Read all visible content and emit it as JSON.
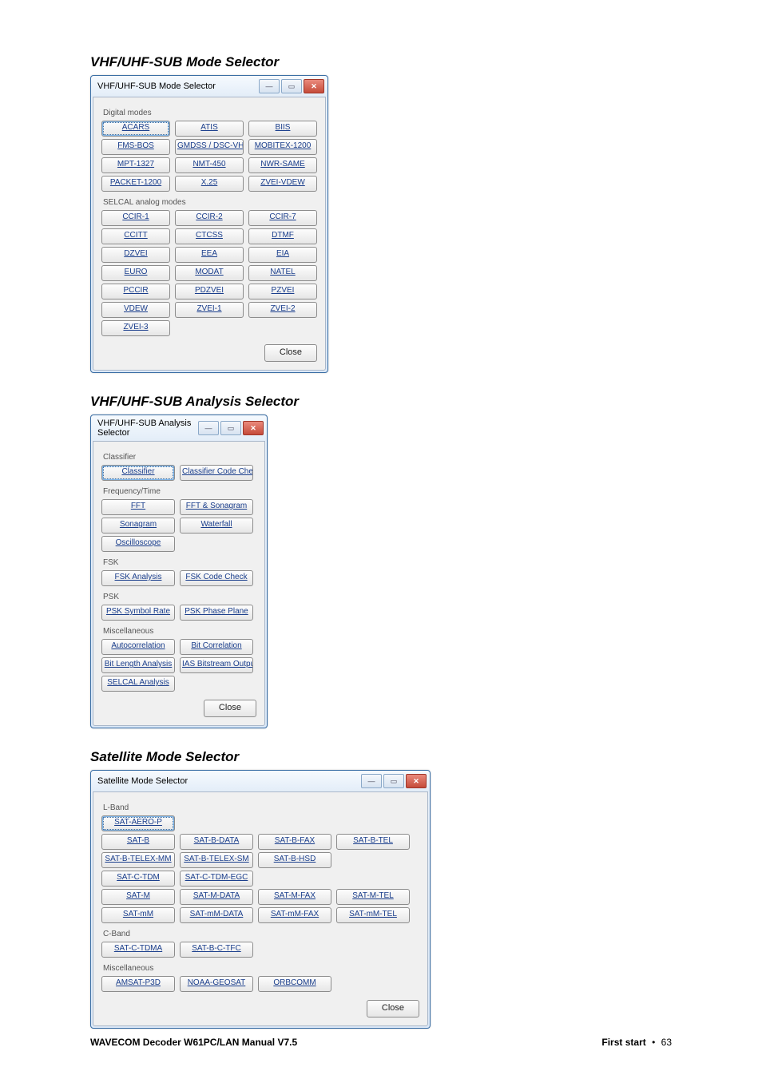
{
  "headings": {
    "h1": "VHF/UHF-SUB Mode Selector",
    "h2": "VHF/UHF-SUB Analysis Selector",
    "h3": "Satellite Mode Selector"
  },
  "win1": {
    "title": "VHF/UHF-SUB Mode Selector",
    "groups": {
      "digital": {
        "label": "Digital modes",
        "items": [
          "ACARS",
          "ATIS",
          "BIIS",
          "FMS-BOS",
          "GMDSS / DSC-VHF",
          "MOBITEX-1200",
          "MPT-1327",
          "NMT-450",
          "NWR-SAME",
          "PACKET-1200",
          "X.25",
          "ZVEI-VDEW"
        ]
      },
      "selcal": {
        "label": "SELCAL analog modes",
        "items": [
          "CCIR-1",
          "CCIR-2",
          "CCIR-7",
          "CCITT",
          "CTCSS",
          "DTMF",
          "DZVEI",
          "EEA",
          "EIA",
          "EURO",
          "MODAT",
          "NATEL",
          "PCCIR",
          "PDZVEI",
          "PZVEI",
          "VDEW",
          "ZVEI-1",
          "ZVEI-2",
          "ZVEI-3"
        ]
      }
    },
    "close": "Close"
  },
  "win2": {
    "title": "VHF/UHF-SUB Analysis Selector",
    "groups": {
      "classifier": {
        "label": "Classifier",
        "items": [
          "Classifier",
          "Classifier Code Check"
        ]
      },
      "freq": {
        "label": "Frequency/Time",
        "items": [
          "FFT",
          "FFT & Sonagram",
          "Sonagram",
          "Waterfall",
          "Oscilloscope"
        ]
      },
      "fsk": {
        "label": "FSK",
        "items": [
          "FSK Analysis",
          "FSK Code Check"
        ]
      },
      "psk": {
        "label": "PSK",
        "items": [
          "PSK Symbol Rate",
          "PSK Phase Plane"
        ]
      },
      "misc": {
        "label": "Miscellaneous",
        "items": [
          "Autocorrelation",
          "Bit Correlation",
          "Bit Length Analysis",
          "IAS Bitstream Output",
          "SELCAL Analysis"
        ]
      }
    },
    "close": "Close"
  },
  "win3": {
    "title": "Satellite Mode Selector",
    "groups": {
      "lband": {
        "label": "L-Band",
        "rows": [
          [
            "SAT-AERO-P"
          ],
          [
            "SAT-B",
            "SAT-B-DATA",
            "SAT-B-FAX",
            "SAT-B-TEL"
          ],
          [
            "SAT-B-TELEX-MM",
            "SAT-B-TELEX-SM",
            "SAT-B-HSD"
          ],
          [
            "SAT-C-TDM",
            "SAT-C-TDM-EGC"
          ],
          [
            "SAT-M",
            "SAT-M-DATA",
            "SAT-M-FAX",
            "SAT-M-TEL"
          ],
          [
            "SAT-mM",
            "SAT-mM-DATA",
            "SAT-mM-FAX",
            "SAT-mM-TEL"
          ]
        ]
      },
      "cband": {
        "label": "C-Band",
        "rows": [
          [
            "SAT-C-TDMA",
            "SAT-B-C-TFC"
          ]
        ]
      },
      "misc": {
        "label": "Miscellaneous",
        "rows": [
          [
            "AMSAT-P3D",
            "NOAA-GEOSAT",
            "ORBCOMM"
          ]
        ]
      }
    },
    "close": "Close"
  },
  "footer": {
    "left": "WAVECOM Decoder W61PC/LAN Manual V7.5",
    "right_section": "First start",
    "right_page": "63"
  }
}
